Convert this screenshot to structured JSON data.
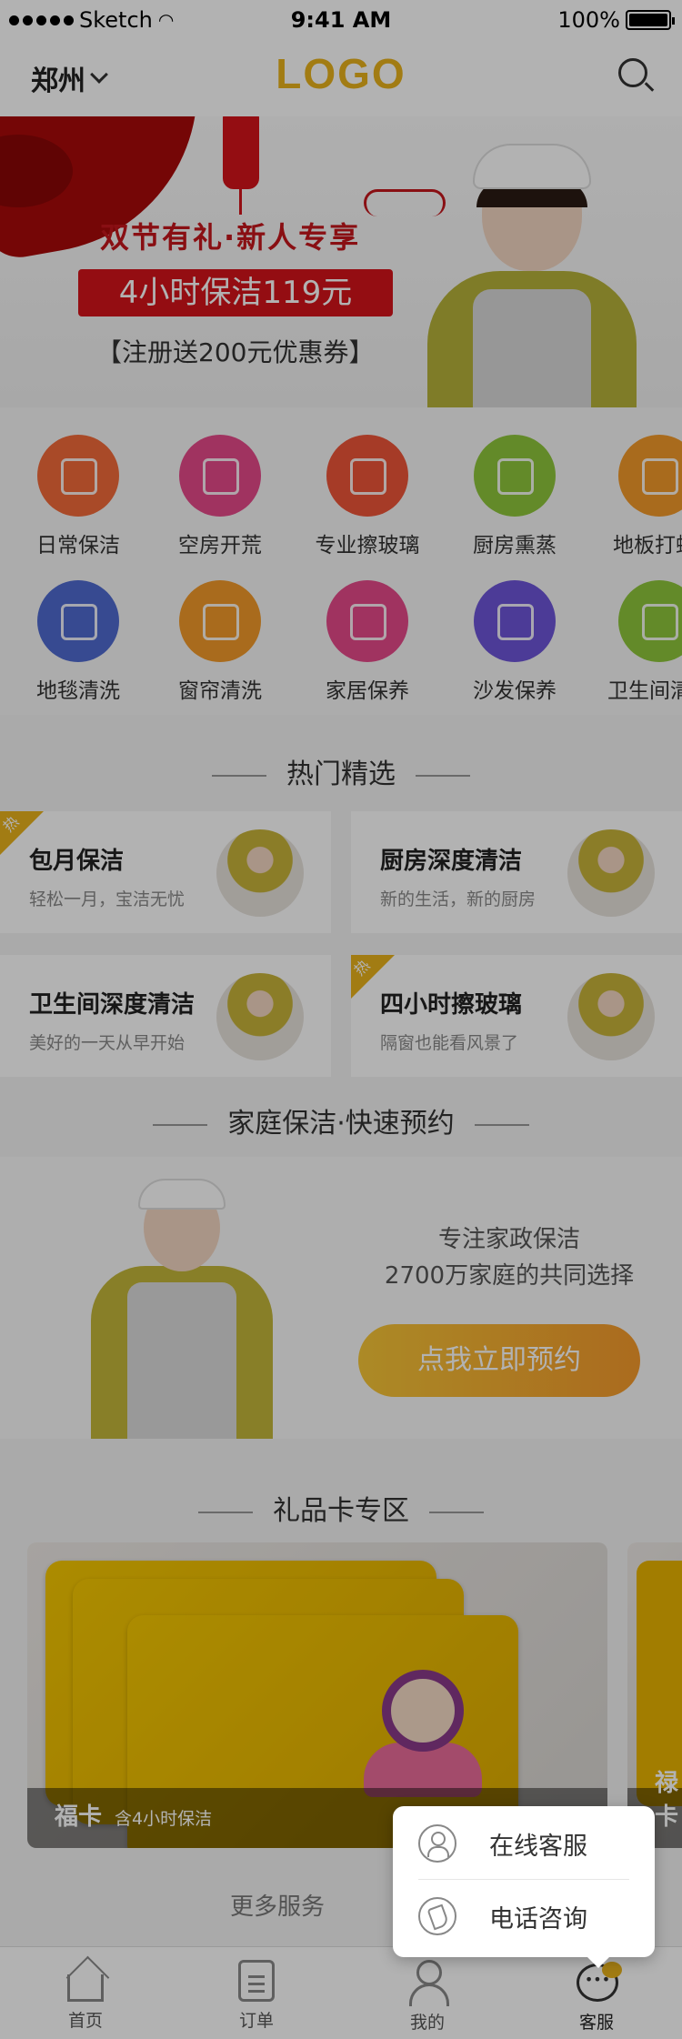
{
  "status_bar": {
    "carrier": "Sketch",
    "time": "9:41 AM",
    "battery": "100%"
  },
  "header": {
    "city": "郑州",
    "logo": "LOGO"
  },
  "banner": {
    "title": "双节有礼·新人专享",
    "price_tag": "4小时保洁119元",
    "coupon": "【注册送200元优惠券】"
  },
  "services": [
    {
      "label": "日常保洁",
      "icon": "broom-icon",
      "color": "#f26a3a"
    },
    {
      "label": "空房开荒",
      "icon": "house-icon",
      "color": "#e64a8a"
    },
    {
      "label": "专业擦玻璃",
      "icon": "window-icon",
      "color": "#ee5538"
    },
    {
      "label": "厨房熏蒸",
      "icon": "pot-icon",
      "color": "#8fc63c"
    },
    {
      "label": "地板打蜡",
      "icon": "roller-icon",
      "color": "#f39a2a"
    },
    {
      "label": "地毯清洗",
      "icon": "carpet-icon",
      "color": "#4f6ad0"
    },
    {
      "label": "窗帘清洗",
      "icon": "curtain-icon",
      "color": "#f39a2a"
    },
    {
      "label": "家居保养",
      "icon": "sofa-home-icon",
      "color": "#e64a8a"
    },
    {
      "label": "沙发保养",
      "icon": "sofa-icon",
      "color": "#6d55d8"
    },
    {
      "label": "卫生间清",
      "icon": "shower-icon",
      "color": "#8fc63c"
    }
  ],
  "hot_section": {
    "title": "热门精选",
    "tag": "热",
    "cards": [
      {
        "title": "包月保洁",
        "subtitle": "轻松一月，宝洁无忧",
        "hot": true
      },
      {
        "title": "厨房深度清洁",
        "subtitle": "新的生活，新的厨房",
        "hot": false
      },
      {
        "title": "卫生间深度清洁",
        "subtitle": "美好的一天从早开始",
        "hot": false
      },
      {
        "title": "四小时擦玻璃",
        "subtitle": "隔窗也能看风景了",
        "hot": true
      }
    ]
  },
  "booking": {
    "title": "家庭保洁·快速预约",
    "line1": "专注家政保洁",
    "line2": "2700万家庭的共同选择",
    "button": "点我立即预约"
  },
  "gift_section": {
    "title": "礼品卡专区",
    "cards": [
      {
        "name": "福卡",
        "desc": "含4小时保洁"
      },
      {
        "name": "禄卡",
        "desc": ""
      }
    ]
  },
  "more": "更多服务",
  "popup": {
    "items": [
      {
        "label": "在线客服",
        "icon": "person-icon"
      },
      {
        "label": "电话咨询",
        "icon": "phone-icon"
      }
    ]
  },
  "tabbar": {
    "items": [
      {
        "label": "首页",
        "icon": "home-icon"
      },
      {
        "label": "订单",
        "icon": "order-icon"
      },
      {
        "label": "我的",
        "icon": "user-icon"
      },
      {
        "label": "客服",
        "icon": "chat-icon"
      }
    ]
  }
}
